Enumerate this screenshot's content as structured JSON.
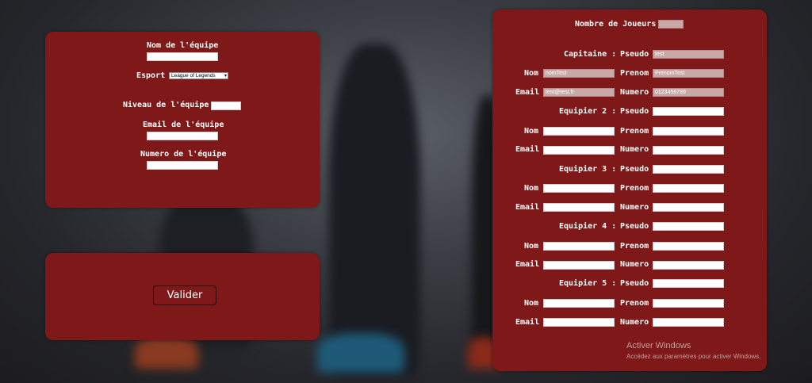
{
  "team": {
    "name_label": "Nom de l'équipe",
    "esport_label": "Esport",
    "esport_value": "League of Legends",
    "level_label": "Niveau de l'équipe",
    "email_label": "Email de l'équipe",
    "number_label": "Numero de l'équipe"
  },
  "submit_label": "Valider",
  "players": {
    "count_label": "Nombre de Joueurs",
    "labels": {
      "pseudo": "Pseudo",
      "nom": "Nom",
      "prenom": "Prenom",
      "email": "Email",
      "numero": "Numero"
    },
    "captain": {
      "title": "Capitaine :",
      "pseudo": "test",
      "nom": "nomTest",
      "prenom": "PrenomTest",
      "email": "test@test.fr",
      "numero": "0123456789"
    },
    "members": [
      {
        "title": "Equipier 2 :"
      },
      {
        "title": "Equipier 3 :"
      },
      {
        "title": "Equipier 4 :"
      },
      {
        "title": "Equipier 5 :"
      }
    ]
  },
  "watermark": {
    "title": "Activer Windows",
    "subtitle": "Accédez aux paramètres pour activer Windows."
  }
}
